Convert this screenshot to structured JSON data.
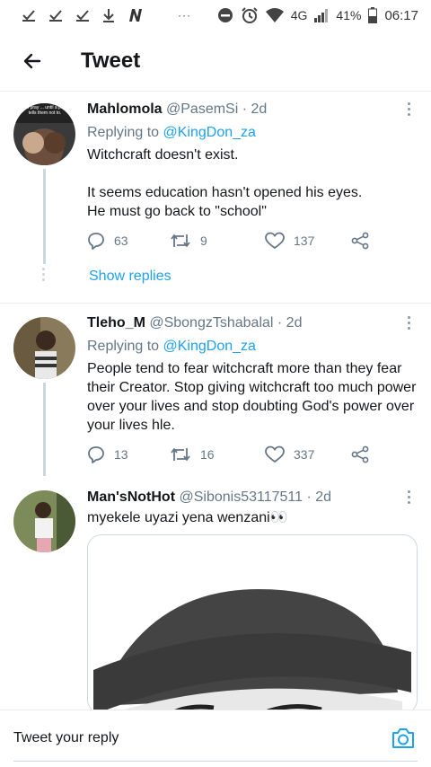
{
  "status_bar": {
    "network": "4G",
    "battery": "41%",
    "time": "06:17",
    "dots": "···"
  },
  "header": {
    "title": "Tweet"
  },
  "tweets": [
    {
      "name": "Mahlomola",
      "handle": "@PasemSi",
      "time": "· 2d",
      "replying_prefix": "Replying to ",
      "replying_to": "@KingDon_za",
      "text": "Witchcraft doesn't exist.\n\nIt seems education hasn't opened his eyes.\nHe must go back to \"school\"",
      "replies": "63",
      "retweets": "9",
      "likes": "137",
      "show_replies": "Show replies",
      "avatar_caption": "...will pray ... until a pers... tells them not to."
    },
    {
      "name": "Tleho_M",
      "handle": "@SbongzTshabalal",
      "time": "· 2d",
      "replying_prefix": "Replying to ",
      "replying_to": "@KingDon_za",
      "text": "People tend to fear witchcraft more than they fear their Creator. Stop giving witchcraft too much power over your lives and stop doubting God's power over your lives hle.",
      "replies": "13",
      "retweets": "16",
      "likes": "337"
    },
    {
      "name": "Man'sNotHot",
      "handle": "@Sibonis53117511",
      "time": "· 2d",
      "text": "myekele uyazi yena wenzani👀"
    }
  ],
  "reply_bar": {
    "placeholder": "Tweet your reply"
  },
  "colors": {
    "accent": "#1da1f2",
    "secondary_text": "#657786",
    "border": "#e6ecf0"
  }
}
